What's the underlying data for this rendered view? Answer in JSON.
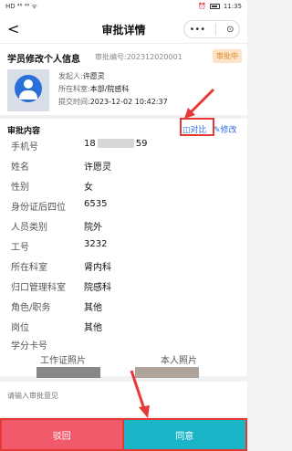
{
  "status_bar": {
    "left_text": "HD ⁴⁶ ⁴⁶ ᯤ",
    "right_text": "11:35",
    "battery": "battery-icon",
    "alarm": "alarm-icon"
  },
  "nav": {
    "back": "<",
    "title": "审批详情",
    "more": "•••",
    "target": "⊙"
  },
  "header": {
    "title": "学员修改个人信息",
    "number": "审批编号:202312020001",
    "status": "审批中",
    "initiator_label": "发起人:",
    "initiator": "许愿灵",
    "dept_label": "所在科室:",
    "dept": "本部/院感科",
    "time_label": "提交时间:",
    "time": "2023-12-02 10:42:37"
  },
  "content": {
    "section_title": "审批内容",
    "compare": "对比",
    "edit": "修改",
    "fields": [
      {
        "label": "手机号",
        "value_prefix": "18",
        "value_suffix": "59"
      },
      {
        "label": "姓名",
        "value": "许愿灵"
      },
      {
        "label": "性别",
        "value": "女"
      },
      {
        "label": "身份证后四位",
        "value": "6535"
      },
      {
        "label": "人员类别",
        "value": "院外"
      },
      {
        "label": "工号",
        "value": "3232"
      },
      {
        "label": "所在科室",
        "value": "肾内科"
      },
      {
        "label": "归口管理科室",
        "value": "院感科"
      },
      {
        "label": "角色/职务",
        "value": "其他"
      },
      {
        "label": "岗位",
        "value": "其他"
      },
      {
        "label": "学分卡号",
        "value": ""
      }
    ],
    "photo_work": "工作证照片",
    "photo_self": "本人照片"
  },
  "opinion": {
    "placeholder": "请输入审批意见"
  },
  "buttons": {
    "reject": "驳回",
    "agree": "同意"
  },
  "colors": {
    "accent": "#2a6fd8",
    "reject": "#f05a6b",
    "agree": "#1ab5c6",
    "annotation": "#e53935"
  }
}
